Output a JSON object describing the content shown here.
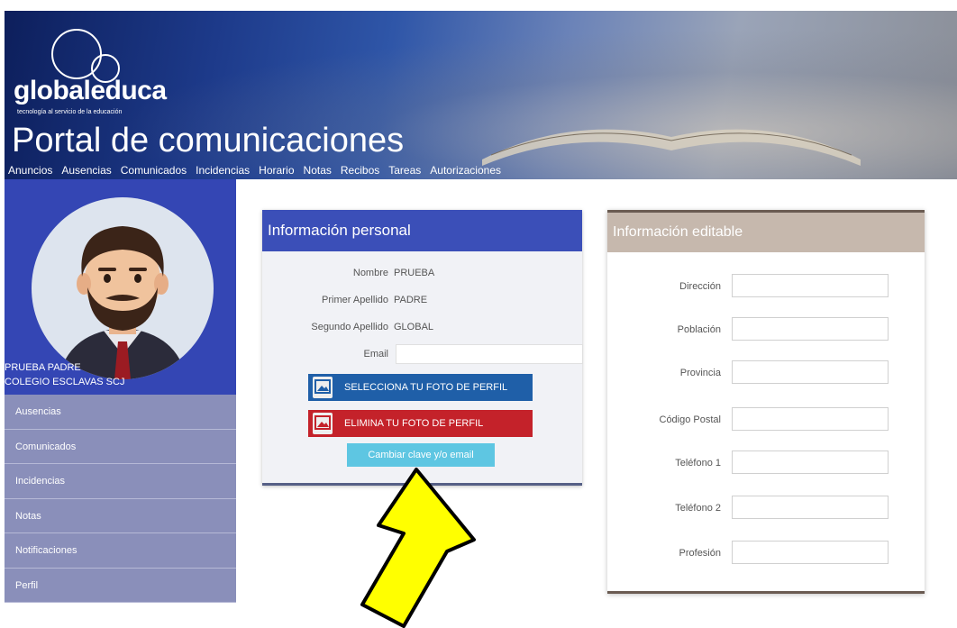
{
  "header": {
    "logo": "globaleduca",
    "tagline": "tecnología al servicio de la educación",
    "title": "Portal de comunicaciones",
    "nav": [
      "Anuncios",
      "Ausencias",
      "Comunicados",
      "Incidencias",
      "Horario",
      "Notas",
      "Recibos",
      "Tareas",
      "Autorizaciones"
    ]
  },
  "sidebar": {
    "name": "PRUEBA PADRE",
    "school": "COLEGIO ESCLAVAS SCJ",
    "menu": [
      "Ausencias",
      "Comunicados",
      "Incidencias",
      "Notas",
      "Notificaciones",
      "Perfil"
    ]
  },
  "personal": {
    "title": "Información personal",
    "fields": [
      {
        "label": "Nombre",
        "value": "PRUEBA"
      },
      {
        "label": "Primer Apellido",
        "value": "PADRE"
      },
      {
        "label": "Segundo Apellido",
        "value": "GLOBAL"
      },
      {
        "label": "Email",
        "value": ""
      }
    ],
    "select_photo_label": "SELECCIONA TU FOTO DE PERFIL",
    "delete_photo_label": "ELIMINA TU FOTO DE PERFIL",
    "change_label": "Cambiar clave y/o email"
  },
  "editable": {
    "title": "Información editable",
    "fields": [
      "Dirección",
      "Población",
      "Provincia",
      "Código Postal",
      "Teléfono 1",
      "Teléfono 2",
      "Profesión"
    ]
  },
  "colors": {
    "accent_blue": "#3b4fb8",
    "select_button": "#1f5fa8",
    "delete_button": "#c4222a",
    "change_button": "#5ec6e2",
    "arrow": "#ffff00"
  }
}
